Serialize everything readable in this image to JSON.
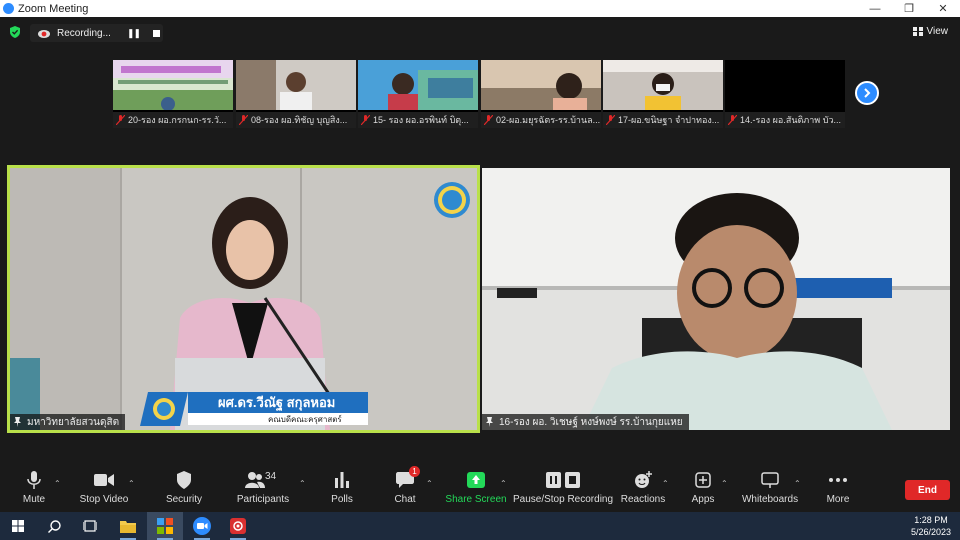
{
  "window": {
    "title": "Zoom Meeting"
  },
  "recording": {
    "label": "Recording..."
  },
  "view_label": "View",
  "strip": [
    {
      "name": "20-รอง ผอ.กรกนก-รร.วั..."
    },
    {
      "name": "08-รอง ผอ.ทิชัญ บุญสิง..."
    },
    {
      "name": "15- รอง ผอ.อรพินท์ บิตุ..."
    },
    {
      "name": "02-ผอ.มยุรฉัตร-รร.บ้านล..."
    },
    {
      "name": "17-ผอ.ขนิษฐา จำปาทอง..."
    },
    {
      "name": "14.-รอง ผอ.สันติภาพ บัว..."
    }
  ],
  "main_left": {
    "name": "มหาวิทยาลัยสวนดุสิต",
    "lower_third_name": "ผศ.ดร.วีณัฐ สกุลหอม",
    "lower_third_sub": "คณบดีคณะครุศาสตร์"
  },
  "main_right": {
    "name": "16-รอง ผอ. วิเชษฐ์ หงษ์พงษ์ รร.บ้านกุยแหย"
  },
  "toolbar": {
    "mute": "Mute",
    "stop_video": "Stop Video",
    "security": "Security",
    "participants": "Participants",
    "participants_count": "34",
    "polls": "Polls",
    "chat": "Chat",
    "chat_badge": "1",
    "share_screen": "Share Screen",
    "pause_stop_recording": "Pause/Stop Recording",
    "reactions": "Reactions",
    "apps": "Apps",
    "whiteboards": "Whiteboards",
    "more": "More",
    "end": "End"
  },
  "taskbar": {
    "time": "1:28 PM",
    "date": "5/26/2023"
  },
  "colors": {
    "active_speaker": "#b9e04a",
    "zoom_blue": "#2d8cff",
    "end_red": "#e02828",
    "share_green": "#23d959"
  }
}
